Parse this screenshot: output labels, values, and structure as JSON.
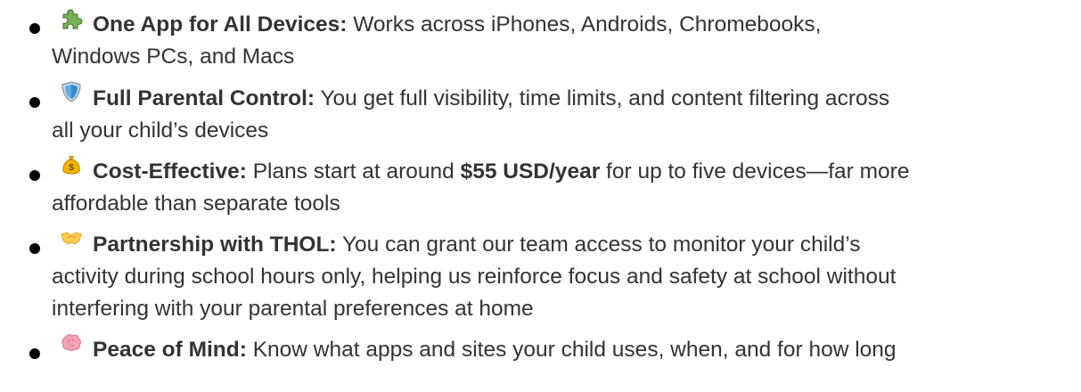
{
  "list": {
    "items": [
      {
        "icon": "puzzle-piece-icon",
        "title": "One App for All Devices:",
        "segments": [
          {
            "text": " Works across iPhones, Androids, Chromebooks,"
          },
          {
            "text": "Windows PCs, and Macs"
          }
        ]
      },
      {
        "icon": "shield-icon",
        "title": "Full Parental Control:",
        "segments": [
          {
            "text": " You get full visibility, time limits, and content filtering across"
          },
          {
            "text": "all your child’s devices"
          }
        ]
      },
      {
        "icon": "money-bag-icon",
        "title": "Cost-Effective:",
        "segments": [
          {
            "text": " Plans start at around "
          },
          {
            "bold": "$55 USD/year"
          },
          {
            "text": " for up to five devices—far more"
          },
          {
            "text": "affordable than separate tools"
          }
        ]
      },
      {
        "icon": "handshake-icon",
        "title": "Partnership with THOL:",
        "segments": [
          {
            "text": " You can grant our team access to monitor your child’s"
          },
          {
            "text": "activity during school hours only, helping us reinforce focus and safety at school without"
          },
          {
            "text": "interfering with your parental preferences at home"
          }
        ]
      },
      {
        "icon": "brain-icon",
        "title": "Peace of Mind:",
        "segments": [
          {
            "text": " Know what apps and sites your child uses, when, and for how long"
          }
        ]
      }
    ]
  }
}
